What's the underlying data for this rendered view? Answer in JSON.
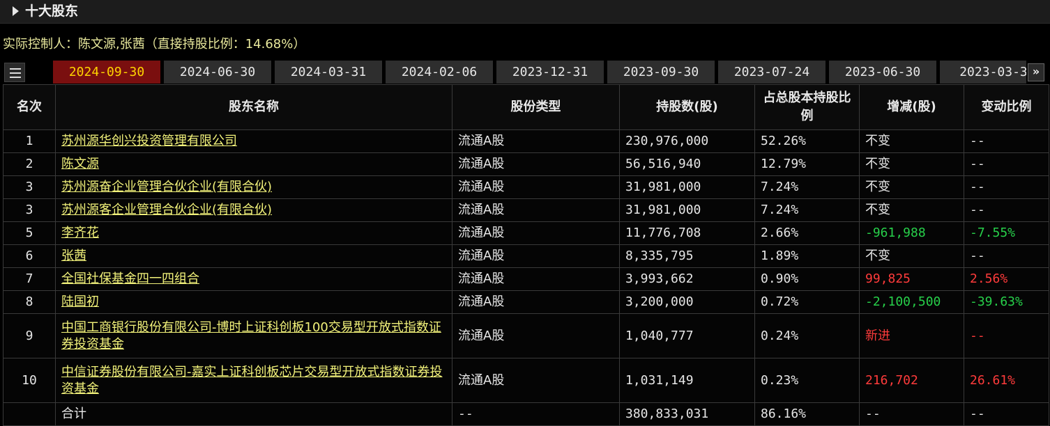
{
  "section": {
    "title": "十大股东"
  },
  "controller_text": "实际控制人：陈文源,张茜（直接持股比例：14.68%）",
  "tabs": [
    "2024-09-30",
    "2024-06-30",
    "2024-03-31",
    "2024-02-06",
    "2023-12-31",
    "2023-09-30",
    "2023-07-24",
    "2023-06-30",
    "2023-03-3"
  ],
  "active_tab": 0,
  "columns": [
    "名次",
    "股东名称",
    "股份类型",
    "持股数(股)",
    "占总股本持股比例",
    "增减(股)",
    "变动比例"
  ],
  "rows": [
    {
      "rank": "1",
      "name": "苏州源华创兴投资管理有限公司",
      "type": "流通A股",
      "shares": "230,976,000",
      "pct": "52.26%",
      "change": "不变",
      "ratio": "--",
      "trend": "flat"
    },
    {
      "rank": "2",
      "name": "陈文源",
      "type": "流通A股",
      "shares": "56,516,940",
      "pct": "12.79%",
      "change": "不变",
      "ratio": "--",
      "trend": "flat"
    },
    {
      "rank": "3",
      "name": "苏州源奋企业管理合伙企业(有限合伙)",
      "type": "流通A股",
      "shares": "31,981,000",
      "pct": "7.24%",
      "change": "不变",
      "ratio": "--",
      "trend": "flat"
    },
    {
      "rank": "3",
      "name": "苏州源客企业管理合伙企业(有限合伙)",
      "type": "流通A股",
      "shares": "31,981,000",
      "pct": "7.24%",
      "change": "不变",
      "ratio": "--",
      "trend": "flat"
    },
    {
      "rank": "5",
      "name": "李齐花",
      "type": "流通A股",
      "shares": "11,776,708",
      "pct": "2.66%",
      "change": "-961,988",
      "ratio": "-7.55%",
      "trend": "down"
    },
    {
      "rank": "6",
      "name": "张茜",
      "type": "流通A股",
      "shares": "8,335,795",
      "pct": "1.89%",
      "change": "不变",
      "ratio": "--",
      "trend": "flat"
    },
    {
      "rank": "7",
      "name": "全国社保基金四一四组合",
      "type": "流通A股",
      "shares": "3,993,662",
      "pct": "0.90%",
      "change": "99,825",
      "ratio": "2.56%",
      "trend": "up"
    },
    {
      "rank": "8",
      "name": "陆国初",
      "type": "流通A股",
      "shares": "3,200,000",
      "pct": "0.72%",
      "change": "-2,100,500",
      "ratio": "-39.63%",
      "trend": "down"
    },
    {
      "rank": "9",
      "name": "中国工商银行股份有限公司-博时上证科创板100交易型开放式指数证券投资基金",
      "type": "流通A股",
      "shares": "1,040,777",
      "pct": "0.24%",
      "change": "新进",
      "ratio": "--",
      "trend": "up",
      "tall": true
    },
    {
      "rank": "10",
      "name": "中信证券股份有限公司-嘉实上证科创板芯片交易型开放式指数证券投资基金",
      "type": "流通A股",
      "shares": "1,031,149",
      "pct": "0.23%",
      "change": "216,702",
      "ratio": "26.61%",
      "trend": "up",
      "tall": true
    }
  ],
  "total": {
    "label": "合计",
    "type": "--",
    "shares": "380,833,031",
    "pct": "86.16%",
    "change": "--",
    "ratio": "--"
  }
}
